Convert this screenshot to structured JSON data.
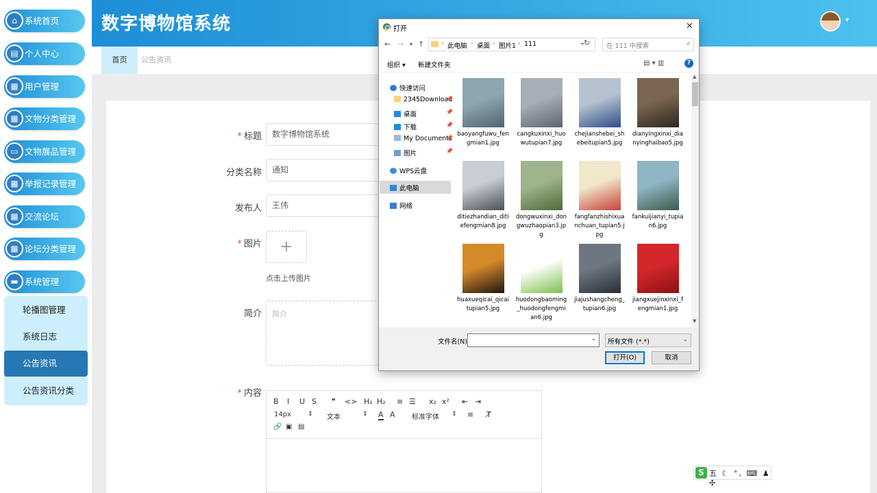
{
  "sidebar": {
    "items": [
      {
        "label": "系统首页",
        "icon": "home-icon",
        "glyph": "⌂"
      },
      {
        "label": "个人中心",
        "icon": "profile-icon",
        "glyph": "▤"
      },
      {
        "label": "用户管理",
        "icon": "grid-icon",
        "glyph": "▦"
      },
      {
        "label": "文物分类管理",
        "icon": "grid-icon",
        "glyph": "▦"
      },
      {
        "label": "文物展品管理",
        "icon": "monitor-icon",
        "glyph": "▭"
      },
      {
        "label": "举报记录管理",
        "icon": "grid-icon",
        "glyph": "▦"
      },
      {
        "label": "交流论坛",
        "icon": "grid-icon",
        "glyph": "▦"
      },
      {
        "label": "论坛分类管理",
        "icon": "grid-icon",
        "glyph": "▦"
      },
      {
        "label": "系统管理",
        "icon": "chat-icon",
        "glyph": "▬"
      }
    ],
    "submenu": [
      {
        "label": "轮播图管理"
      },
      {
        "label": "系统日志"
      },
      {
        "label": "公告资讯"
      },
      {
        "label": "公告资讯分类"
      }
    ]
  },
  "header": {
    "title": "数字博物馆系统",
    "caret": "▾"
  },
  "tabs": [
    {
      "label": "首页"
    },
    {
      "label": "公告资讯"
    }
  ],
  "form": {
    "title": {
      "label": "标题",
      "required": "*",
      "value": "数字博物馆系统"
    },
    "category": {
      "label": "分类名称",
      "value": "通知"
    },
    "publisher": {
      "label": "发布人",
      "value": "王伟"
    },
    "image": {
      "label": "图片",
      "required": "*",
      "plus": "+",
      "hint": "点击上传图片"
    },
    "intro": {
      "label": "简介",
      "placeholder": "简介"
    },
    "content": {
      "label": "内容",
      "required": "*"
    }
  },
  "editor": {
    "row1": [
      "B",
      "I",
      "U",
      "S",
      "❞",
      "<>",
      "H₁",
      "H₂",
      "≡",
      "☰",
      "x₂",
      "x²",
      "⇤",
      "⇥"
    ],
    "font_size": "14px",
    "paragraph": "文本",
    "font_family": "标准字体",
    "row3": [
      "🔗",
      "▣",
      "▤"
    ]
  },
  "dialog": {
    "title": "打开",
    "close": "✕",
    "nav_back": "←",
    "nav_forward": "→",
    "nav_dropdown": "▾",
    "nav_up": "↑",
    "breadcrumb": [
      "此电脑",
      "桌面",
      "图片1",
      "111"
    ],
    "crumb_sep": "›",
    "addr_dropdown": "⌄",
    "refresh": "↻",
    "search_placeholder": "在 111 中搜索",
    "search_icon": "⌕",
    "organize": "组织 ▾",
    "new_folder": "新建文件夹",
    "view_icons": "▤ ▾   ▥",
    "help": "?",
    "nav_pane": [
      {
        "label": "快速访问",
        "icon": "star-icon",
        "color": "#2f7ad6"
      },
      {
        "label": "2345Download",
        "icon": "folder-icon",
        "color": "#f5d37a",
        "pinned": "📌"
      },
      {
        "label": "桌面",
        "icon": "desktop-icon",
        "color": "#1c8de0",
        "pinned": "📌"
      },
      {
        "label": "下载",
        "icon": "download-icon",
        "color": "#1c8de0",
        "pinned": "📌"
      },
      {
        "label": "My Documents",
        "icon": "document-icon",
        "color": "#9db9d6",
        "pinned": "📌"
      },
      {
        "label": "图片",
        "icon": "pictures-icon",
        "color": "#6aa0cf",
        "pinned": "📌"
      },
      {
        "label": "WPS云盘",
        "icon": "cloud-icon",
        "color": "#3a8ee6"
      },
      {
        "label": "此电脑",
        "icon": "pc-icon",
        "color": "#2f86d6"
      },
      {
        "label": "网络",
        "icon": "network-icon",
        "color": "#3a7bd5"
      }
    ],
    "files": [
      {
        "name": "baoyangfuwu_fengmian1.jpg",
        "c1": "#8da6b0",
        "c2": "#4f6570"
      },
      {
        "name": "cangkuxinxi_huowutupian7.jpg",
        "c1": "#a8aeb8",
        "c2": "#5b6472"
      },
      {
        "name": "chejianshebei_shebeitupian5.jpg",
        "c1": "#b6c2d0",
        "c2": "#2f4d8a"
      },
      {
        "name": "dianyingxinxi_dianyinghaibao5.jpg",
        "c1": "#7a6650",
        "c2": "#2c2620"
      },
      {
        "name": "ditiezhandian_ditiefengmian8.jpg",
        "c1": "#c9ced4",
        "c2": "#4a5058"
      },
      {
        "name": "dongwuxinxi_dongwuzhaopian3.jpg",
        "c1": "#9eb48a",
        "c2": "#4f6a3a"
      },
      {
        "name": "fangfanzhishixuanchuan_tupian5.jpg",
        "c1": "#f1e7c9",
        "c2": "#c8423a"
      },
      {
        "name": "fankuijianyi_tupian6.jpg",
        "c1": "#8fb6c4",
        "c2": "#3e5a4b"
      },
      {
        "name": "huaxueqicai_qicaitupian5.jpg",
        "c1": "#d58a2a",
        "c2": "#1e1510"
      },
      {
        "name": "huodongbaoming_huodongfengmian6.jpg",
        "c1": "#ffffff",
        "c2": "#7cc04b"
      },
      {
        "name": "jiajushangcheng_tupian6.jpg",
        "c1": "#6e7682",
        "c2": "#2a2e35"
      },
      {
        "name": "jiangxuejinxinxi_fengmian1.jpg",
        "c1": "#d4272b",
        "c2": "#8e1014"
      }
    ],
    "scroll_up": "▲",
    "scroll_down": "▼",
    "filename_label": "文件名(N):",
    "filename_value": "",
    "filename_dropdown": "⌄",
    "filetype": "所有文件 (*.*)",
    "filetype_dropdown": "⌄",
    "open_btn": "打开(O)",
    "cancel_btn": "取消"
  },
  "ime": {
    "logo": "S",
    "text": "五 ☾ °, ⌨ ♟ ✣"
  }
}
